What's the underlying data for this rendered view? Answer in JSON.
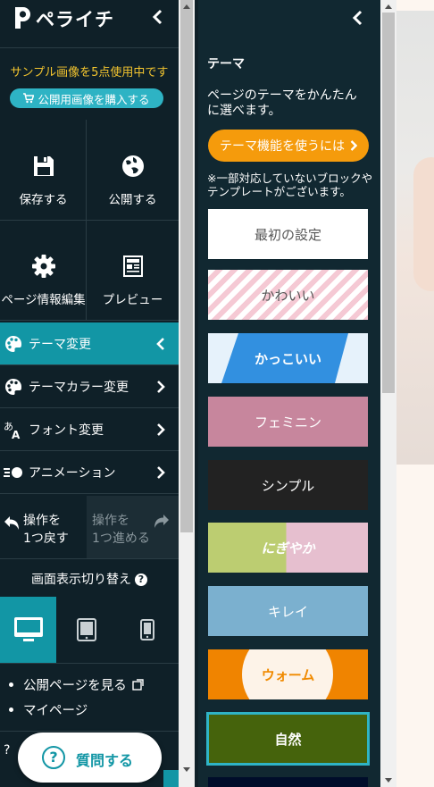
{
  "app": {
    "logo_text": "ペライチ",
    "sample_notice": "サンプル画像を5点使用中です",
    "buy_button": "公開用画像を購入する"
  },
  "actions": {
    "save": "保存する",
    "publish": "公開する",
    "page_info": "ページ情報編集",
    "preview": "プレビュー"
  },
  "menu": [
    {
      "label": "テーマ変更",
      "active": true
    },
    {
      "label": "テーマカラー変更",
      "active": false
    },
    {
      "label": "フォント変更",
      "active": false
    },
    {
      "label": "アニメーション",
      "active": false
    }
  ],
  "history": {
    "undo_line1": "操作を",
    "undo_line2": "1つ戻す",
    "redo_line1": "操作を",
    "redo_line2": "1つ進める"
  },
  "display": {
    "title": "画面表示切り替え",
    "help_mark": "?",
    "devices": [
      "desktop-icon",
      "tablet-icon",
      "smartphone-icon"
    ],
    "active_device": "desktop"
  },
  "links": {
    "view_public": "公開ページを見る",
    "my_page": "マイページ"
  },
  "help": {
    "label": "質問する",
    "mark": "?"
  },
  "theme_panel": {
    "title": "テーマ",
    "description": "ページのテーマをかんたんに選べます。",
    "howto_button": "テーマ機能を使うには",
    "note": "※一部対応していないブロックやテンプレートがございます。",
    "themes": [
      {
        "label": "最初の設定",
        "text_color": "#555555",
        "style": "default"
      },
      {
        "label": "かわいい",
        "text_color": "#555555",
        "style": "kawaii"
      },
      {
        "label": "かっこいい",
        "text_color": "#ffffff",
        "style": "kakkoii"
      },
      {
        "label": "フェミニン",
        "text_color": "#ffffff",
        "style": "feminine"
      },
      {
        "label": "シンプル",
        "text_color": "#ffffff",
        "style": "simple"
      },
      {
        "label": "にぎやか",
        "text_color": "#ffffff",
        "style": "nigiyaka"
      },
      {
        "label": "キレイ",
        "text_color": "#ffffff",
        "style": "kirei"
      },
      {
        "label": "ウォーム",
        "text_color": "#f08a00",
        "style": "warm"
      },
      {
        "label": "自然",
        "text_color": "#ffffff",
        "style": "nature"
      }
    ],
    "selected_theme": "自然"
  },
  "colors": {
    "sidebar_bg": "#0f2028",
    "panel_bg": "#112831",
    "accent_teal": "#1296a5",
    "notice_yellow": "#f3c52f",
    "howto_orange": "#f59b0c"
  }
}
